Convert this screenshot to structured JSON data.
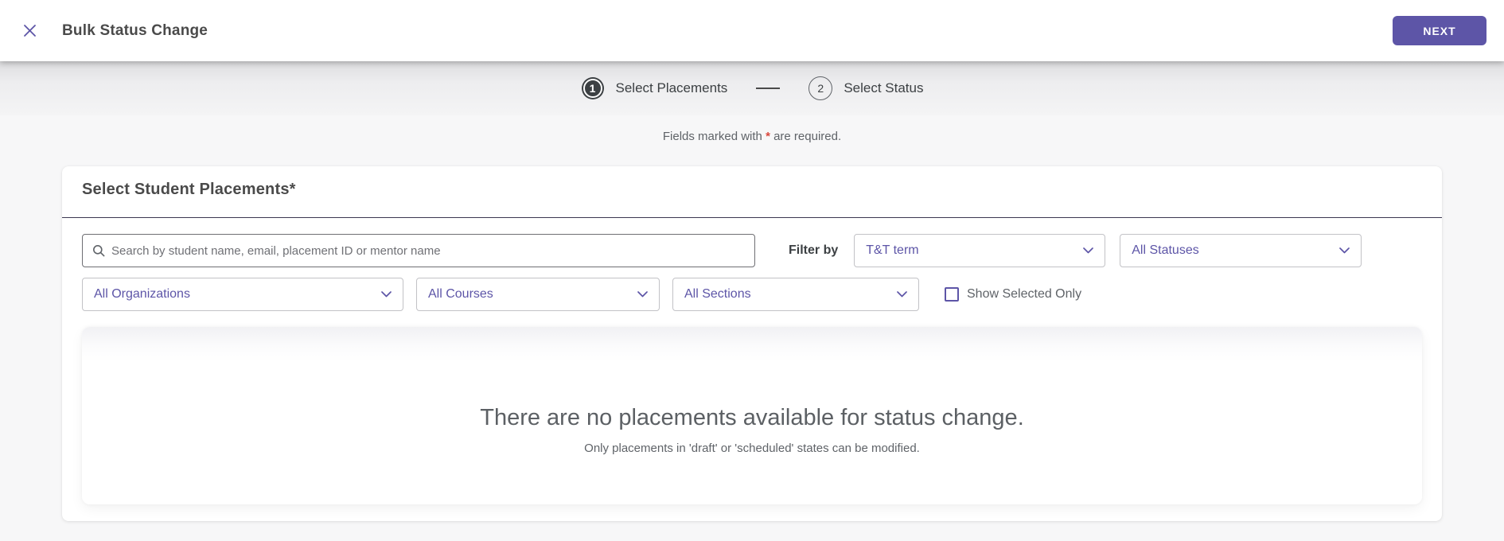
{
  "header": {
    "title": "Bulk Status Change",
    "next_label": "NEXT"
  },
  "stepper": {
    "steps": [
      {
        "number": "1",
        "label": "Select Placements",
        "active": true
      },
      {
        "number": "2",
        "label": "Select Status",
        "active": false
      }
    ]
  },
  "notice": {
    "prefix": "Fields marked with ",
    "asterisk": "*",
    "suffix": " are required."
  },
  "panel": {
    "heading": "Select Student Placements",
    "heading_asterisk": "*",
    "search": {
      "placeholder": "Search by student name, email, placement ID or mentor name",
      "value": "",
      "icon": "search-icon"
    },
    "filter_by_label": "Filter by",
    "filters": {
      "term": "T&T term",
      "statuses": "All Statuses",
      "organizations": "All Organizations",
      "courses": "All Courses",
      "sections": "All Sections"
    },
    "show_selected_only": {
      "label": "Show Selected Only",
      "checked": false
    },
    "empty_state": {
      "title": "There are no placements available for status change.",
      "subtitle": "Only placements in 'draft' or 'scheduled' states can be modified."
    }
  },
  "colors": {
    "accent_purple": "#5D55A7",
    "required_red": "#D9463B",
    "dark_text": "#3C4043",
    "gray_text": "#5F6368",
    "header_divider": "#3B3751"
  }
}
